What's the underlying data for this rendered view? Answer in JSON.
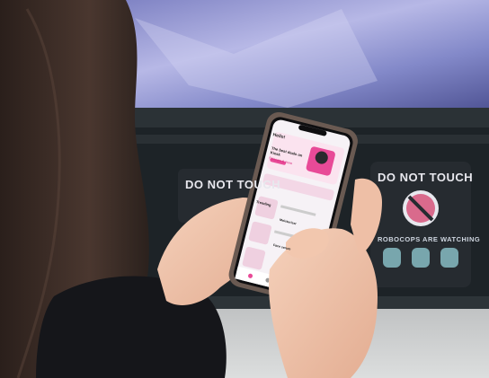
{
  "phone_screen": {
    "app_title": "Hello!",
    "headline": "The best deals on Kiosk",
    "subheadline": "Skincare & more",
    "section_title": "Trending",
    "item_1": "Moisturiser",
    "item_2": "Face serum"
  },
  "signs": {
    "left": "DO NOT TOUCH",
    "right_top": "DO NOT TOUCH",
    "right_bottom": "ROBOCOPS ARE WATCHING"
  },
  "colors": {
    "accent_pink": "#e84a97",
    "screen_bg": "#f6f2f6",
    "kiosk_dark": "#1d2327",
    "hair": "#3a2a24",
    "sweater": "#15161a",
    "skin": "#efc6ae"
  }
}
